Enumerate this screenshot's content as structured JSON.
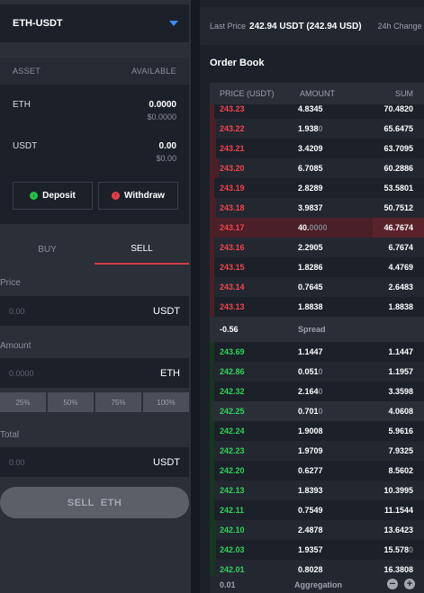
{
  "pair": {
    "label": "ETH-USDT"
  },
  "balances": {
    "header_asset": "ASSET",
    "header_available": "AVAILABLE",
    "items": [
      {
        "asset": "ETH",
        "amount": "0.0000",
        "value": "$0.0000"
      },
      {
        "asset": "USDT",
        "amount": "0.00",
        "value": "$0.00"
      }
    ],
    "deposit_label": "Deposit",
    "withdraw_label": "Withdraw"
  },
  "trade_tabs": {
    "buy": "BUY",
    "sell": "SELL",
    "active": "sell"
  },
  "form": {
    "price_label": "Price",
    "price_placeholder": "0.00",
    "price_unit": "USDT",
    "amount_label": "Amount",
    "amount_placeholder": "0.0000",
    "amount_unit": "ETH",
    "percents": [
      "25%",
      "50%",
      "75%",
      "100%"
    ],
    "total_label": "Total",
    "total_placeholder": "0.00",
    "total_unit": "USDT",
    "submit_label": "SELL  ETH"
  },
  "ticker": {
    "last_price_label": "Last Price",
    "last_price_value": "242.94 USDT (242.94 USD)",
    "change_label": "24h Change"
  },
  "order_book": {
    "title": "Order Book",
    "col_price": "PRICE (USDT)",
    "col_amount": "AMOUNT",
    "col_sum": "SUM",
    "asks": [
      {
        "price": "243.23",
        "amount": "4.8345",
        "dim": "",
        "sum": "70.4820",
        "depth": 0.02
      },
      {
        "price": "243.22",
        "amount": "1.938",
        "dim": "0",
        "sum": "65.6475",
        "depth": 0.03
      },
      {
        "price": "243.21",
        "amount": "3.4209",
        "dim": "",
        "sum": "63.7095",
        "depth": 0.03
      },
      {
        "price": "243.20",
        "amount": "6.7085",
        "dim": "",
        "sum": "60.2886",
        "depth": 0.04
      },
      {
        "price": "243.19",
        "amount": "2.8289",
        "dim": "",
        "sum": "53.5801",
        "depth": 0.02
      },
      {
        "price": "243.18",
        "amount": "3.9837",
        "dim": "",
        "sum": "50.7512",
        "depth": 0.03
      },
      {
        "price": "243.17",
        "amount": "40.",
        "dim": "0000",
        "sum": "46.7674",
        "depth": 0.76
      },
      {
        "price": "243.16",
        "amount": "2.2905",
        "dim": "",
        "sum": "6.7674",
        "depth": 0.02
      },
      {
        "price": "243.15",
        "amount": "1.8286",
        "dim": "",
        "sum": "4.4769",
        "depth": 0.02
      },
      {
        "price": "243.14",
        "amount": "0.7645",
        "dim": "",
        "sum": "2.6483",
        "depth": 0.02
      },
      {
        "price": "243.13",
        "amount": "1.8838",
        "dim": "",
        "sum": "1.8838",
        "depth": 0.02
      }
    ],
    "spread_value": "-0.56",
    "spread_label": "Spread",
    "bids": [
      {
        "price": "243.69",
        "amount": "1.1447",
        "dim": "",
        "sum": "1.1447",
        "depth": 0.02
      },
      {
        "price": "242.86",
        "amount": "0.051",
        "dim": "0",
        "sum": "1.1957",
        "depth": 0.01
      },
      {
        "price": "242.32",
        "amount": "2.164",
        "dim": "0",
        "sum": "3.3598",
        "depth": 0.02
      },
      {
        "price": "242.25",
        "amount": "0.701",
        "dim": "0",
        "sum": "4.0608",
        "depth": 0.01
      },
      {
        "price": "242.24",
        "amount": "1.9008",
        "dim": "",
        "sum": "5.9616",
        "depth": 0.02
      },
      {
        "price": "242.23",
        "amount": "1.9709",
        "dim": "",
        "sum": "7.9325",
        "depth": 0.02
      },
      {
        "price": "242.20",
        "amount": "0.6277",
        "dim": "",
        "sum": "8.5602",
        "depth": 0.02
      },
      {
        "price": "242.13",
        "amount": "1.8393",
        "dim": "",
        "sum": "10.3995",
        "depth": 0.02
      },
      {
        "price": "242.11",
        "amount": "0.7549",
        "dim": "",
        "sum": "11.1544",
        "depth": 0.02
      },
      {
        "price": "242.10",
        "amount": "2.4878",
        "dim": "",
        "sum": "13.6423",
        "depth": 0.03
      },
      {
        "price": "242.03",
        "amount": "1.9357",
        "dim": "",
        "sum": "15.578",
        "sum_dim": "0",
        "depth": 0.03
      },
      {
        "price": "242.01",
        "amount": "0.8028",
        "dim": "",
        "sum": "16.3808",
        "depth": 0.02
      }
    ],
    "aggregation_value": "0.01",
    "aggregation_label": "Aggregation"
  },
  "colors": {
    "ask": "#f0444e",
    "bid": "#2fd35a",
    "accent": "#3b8cff",
    "sell_tab": "#d33b44"
  }
}
